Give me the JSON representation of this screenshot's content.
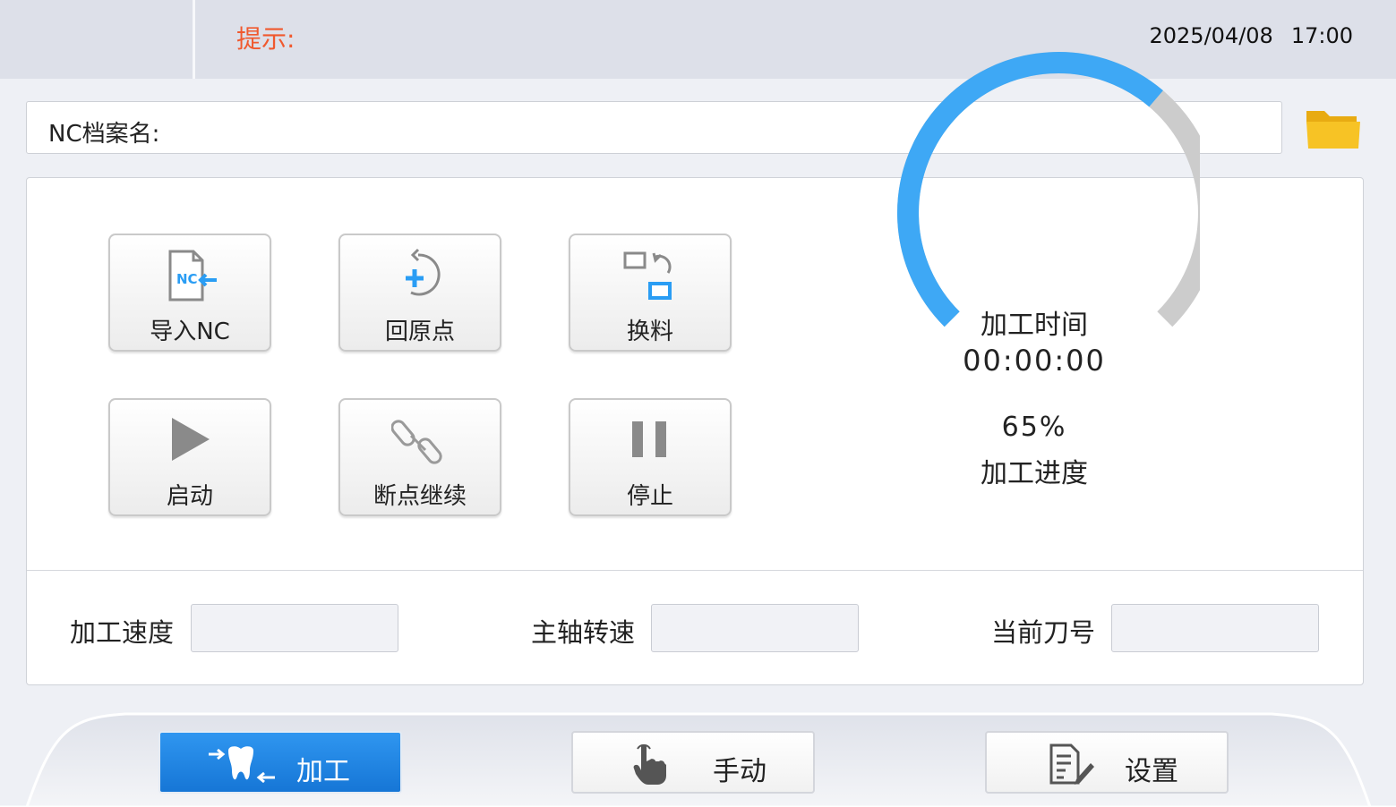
{
  "header": {
    "hint_label": "提示:",
    "date": "2025/04/08",
    "time": "17:00"
  },
  "nc_file": {
    "label": "NC档案名:",
    "value": ""
  },
  "actions": [
    {
      "label": "导入NC",
      "icon": "import-nc-icon"
    },
    {
      "label": "回原点",
      "icon": "return-home-icon"
    },
    {
      "label": "换料",
      "icon": "change-material-icon"
    },
    {
      "label": "启动",
      "icon": "play-icon"
    },
    {
      "label": "断点继续",
      "icon": "link-icon"
    },
    {
      "label": "停止",
      "icon": "pause-icon"
    }
  ],
  "progress": {
    "time_label": "加工时间",
    "time_value": "00:00:00",
    "percent_text": "65%",
    "percent": 65,
    "progress_label": "加工进度",
    "active_color": "#3ea8f5",
    "track_color": "#cccccc"
  },
  "fields": [
    {
      "label": "加工速度",
      "value": ""
    },
    {
      "label": "主轴转速",
      "value": ""
    },
    {
      "label": "当前刀号",
      "value": ""
    }
  ],
  "nav": [
    {
      "label": "加工",
      "icon": "tooth-icon",
      "active": true
    },
    {
      "label": "手动",
      "icon": "hand-pointer-icon",
      "active": false
    },
    {
      "label": "设置",
      "icon": "document-edit-icon",
      "active": false
    }
  ],
  "colors": {
    "hint": "#f0592e",
    "accent": "#1f86e6",
    "folder": "#f7c325"
  }
}
